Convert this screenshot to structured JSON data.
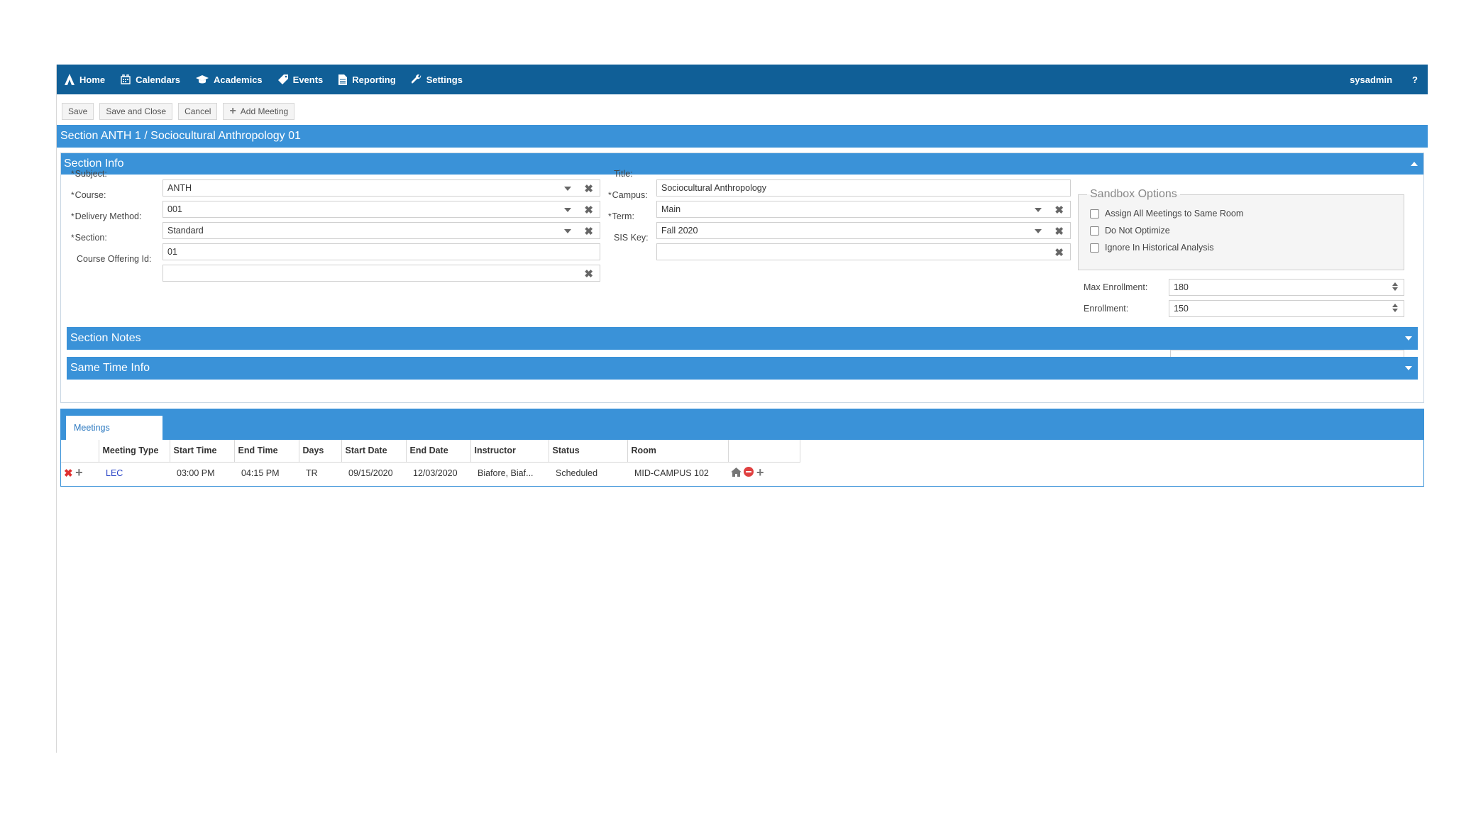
{
  "nav": {
    "items": [
      {
        "label": "Home",
        "icon": "logo-icon"
      },
      {
        "label": "Calendars",
        "icon": "calendar-icon"
      },
      {
        "label": "Academics",
        "icon": "graduation-cap-icon"
      },
      {
        "label": "Events",
        "icon": "tag-icon"
      },
      {
        "label": "Reporting",
        "icon": "document-icon"
      },
      {
        "label": "Settings",
        "icon": "wrench-icon"
      }
    ],
    "user": "sysadmin",
    "help": "?"
  },
  "toolbar": {
    "save": "Save",
    "save_close": "Save and Close",
    "cancel": "Cancel",
    "add_meeting": "Add Meeting"
  },
  "title": "Section ANTH 1 / Sociocultural Anthropology 01",
  "section_info": {
    "header": "Section Info",
    "subject": {
      "label": "Subject:",
      "value": "ANTH"
    },
    "course": {
      "label": "Course:",
      "value": "001"
    },
    "delivery": {
      "label": "Delivery Method:",
      "value": "Standard"
    },
    "section": {
      "label": "Section:",
      "value": "01"
    },
    "offering": {
      "label": "Course Offering Id:",
      "value": ""
    },
    "title": {
      "label": "Title:",
      "value": "Sociocultural Anthropology"
    },
    "campus": {
      "label": "Campus:",
      "value": "Main"
    },
    "term": {
      "label": "Term:",
      "value": "Fall 2020"
    },
    "sis": {
      "label": "SIS Key:",
      "value": ""
    },
    "sandbox": {
      "legend": "Sandbox Options",
      "options": [
        "Assign All Meetings to Same Room",
        "Do Not Optimize",
        "Ignore In Historical Analysis"
      ]
    },
    "max_enrollment": {
      "label": "Max Enrollment:",
      "value": "180"
    },
    "enrollment": {
      "label": "Enrollment:",
      "value": "150"
    }
  },
  "section_notes": "Section Notes",
  "same_time": "Same Time Info",
  "meetings": {
    "tab": "Meetings",
    "columns": [
      "Meeting Type",
      "Start Time",
      "End Time",
      "Days",
      "Start Date",
      "End Date",
      "Instructor",
      "Status",
      "Room"
    ],
    "rows": [
      {
        "type": "LEC",
        "start_time": "03:00 PM",
        "end_time": "04:15 PM",
        "days": "TR",
        "start_date": "09/15/2020",
        "end_date": "12/03/2020",
        "instructor": "Biafore, Biaf...",
        "status": "Scheduled",
        "room": "MID-CAMPUS 102"
      }
    ]
  }
}
